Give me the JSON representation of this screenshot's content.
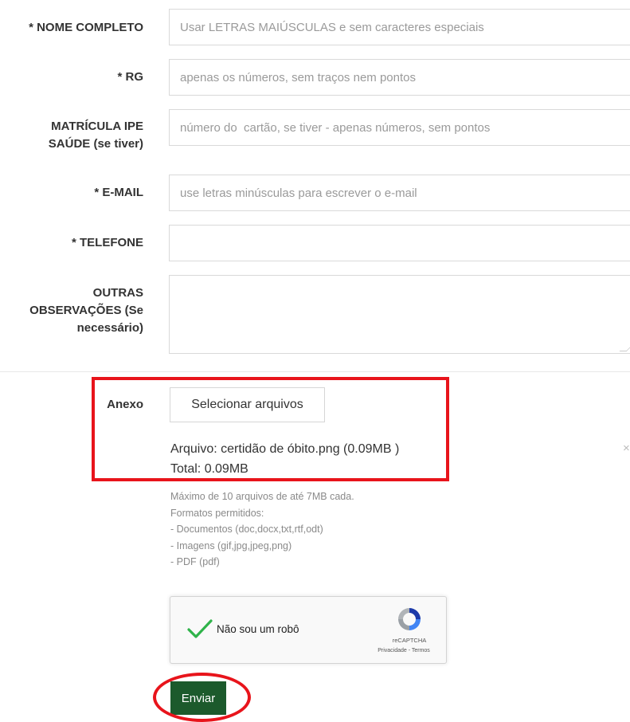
{
  "form": {
    "fields": [
      {
        "label": "* NOME COMPLETO",
        "placeholder": "Usar LETRAS MAIÚSCULAS e sem caracteres especiais",
        "value": ""
      },
      {
        "label": "* RG",
        "placeholder": "apenas os números, sem traços nem pontos",
        "value": ""
      },
      {
        "label_line1": "MATRÍCULA IPE",
        "label_line2": "SAÚDE (se tiver)",
        "placeholder": "número do  cartão, se tiver - apenas números, sem pontos",
        "value": ""
      },
      {
        "label": "* E-MAIL",
        "placeholder": "use letras minúsculas para escrever o e-mail",
        "value": ""
      },
      {
        "label": "* TELEFONE",
        "placeholder": "",
        "value": ""
      },
      {
        "label_line1": "OUTRAS",
        "label_line2": "OBSERVAÇÕES (Se",
        "label_line3": "necessário)",
        "placeholder": "",
        "value": ""
      }
    ],
    "attachment": {
      "label": "Anexo",
      "button_label": "Selecionar arquivos",
      "file_info": "Arquivo: certidão de óbito.png (0.09MB )",
      "total": "Total: 0.09MB",
      "remove_glyph": "×",
      "help_lines": [
        "Máximo de 10 arquivos de até 7MB cada.",
        "Formatos permitidos:",
        "- Documentos (doc,docx,txt,rtf,odt)",
        "- Imagens (gif,jpg,jpeg,png)",
        "- PDF (pdf)"
      ]
    },
    "recaptcha": {
      "checkbox_label": "Não sou um robô",
      "brand": "reCAPTCHA",
      "links": "Privacidade - Termos",
      "checked": true
    },
    "submit_label": "Enviar"
  },
  "colors": {
    "accent_green": "#1c5a2c",
    "highlight_red": "#e8141b",
    "check_green": "#2fb34a"
  },
  "icons": [
    "checkmark-icon",
    "recaptcha-logo-icon",
    "close-icon"
  ]
}
